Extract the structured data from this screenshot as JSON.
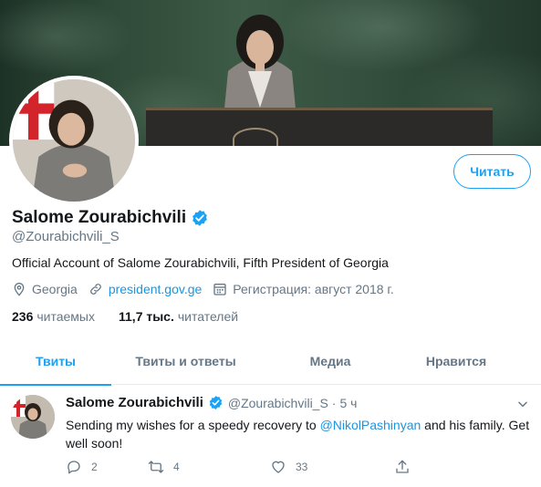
{
  "profile": {
    "display_name": "Salome Zourabichvili",
    "handle": "@Zourabichvili_S",
    "bio": "Official Account of Salome Zourabichvili, Fifth President of Georgia",
    "location": "Georgia",
    "website": "president.gov.ge",
    "joined": "Регистрация: август 2018 г.",
    "follow_label": "Читать",
    "following_count": "236",
    "following_label": "читаемых",
    "followers_count": "11,7 тыс.",
    "followers_label": "читателей",
    "verified": true
  },
  "tabs": [
    {
      "label": "Твиты",
      "active": true
    },
    {
      "label": "Твиты и ответы",
      "active": false
    },
    {
      "label": "Медиа",
      "active": false
    },
    {
      "label": "Нравится",
      "active": false
    }
  ],
  "tweet": {
    "name": "Salome Zourabichvili",
    "handle": "@Zourabichvili_S",
    "separator": "·",
    "time": "5 ч",
    "text_before": "Sending my wishes for a speedy recovery to ",
    "mention": "@NikolPashinyan",
    "text_after": " and his family. Get well soon!",
    "replies": "2",
    "retweets": "4",
    "likes": "33"
  },
  "icons": {
    "verified": "verified-badge-icon",
    "location": "location-pin-icon",
    "link": "link-icon",
    "calendar": "calendar-icon",
    "caret": "chevron-down-icon",
    "reply": "reply-icon",
    "retweet": "retweet-icon",
    "like": "heart-icon",
    "share": "share-icon"
  },
  "colors": {
    "accent": "#1da1f2",
    "link": "#1b95e0",
    "muted": "#657786",
    "text": "#14171a"
  }
}
